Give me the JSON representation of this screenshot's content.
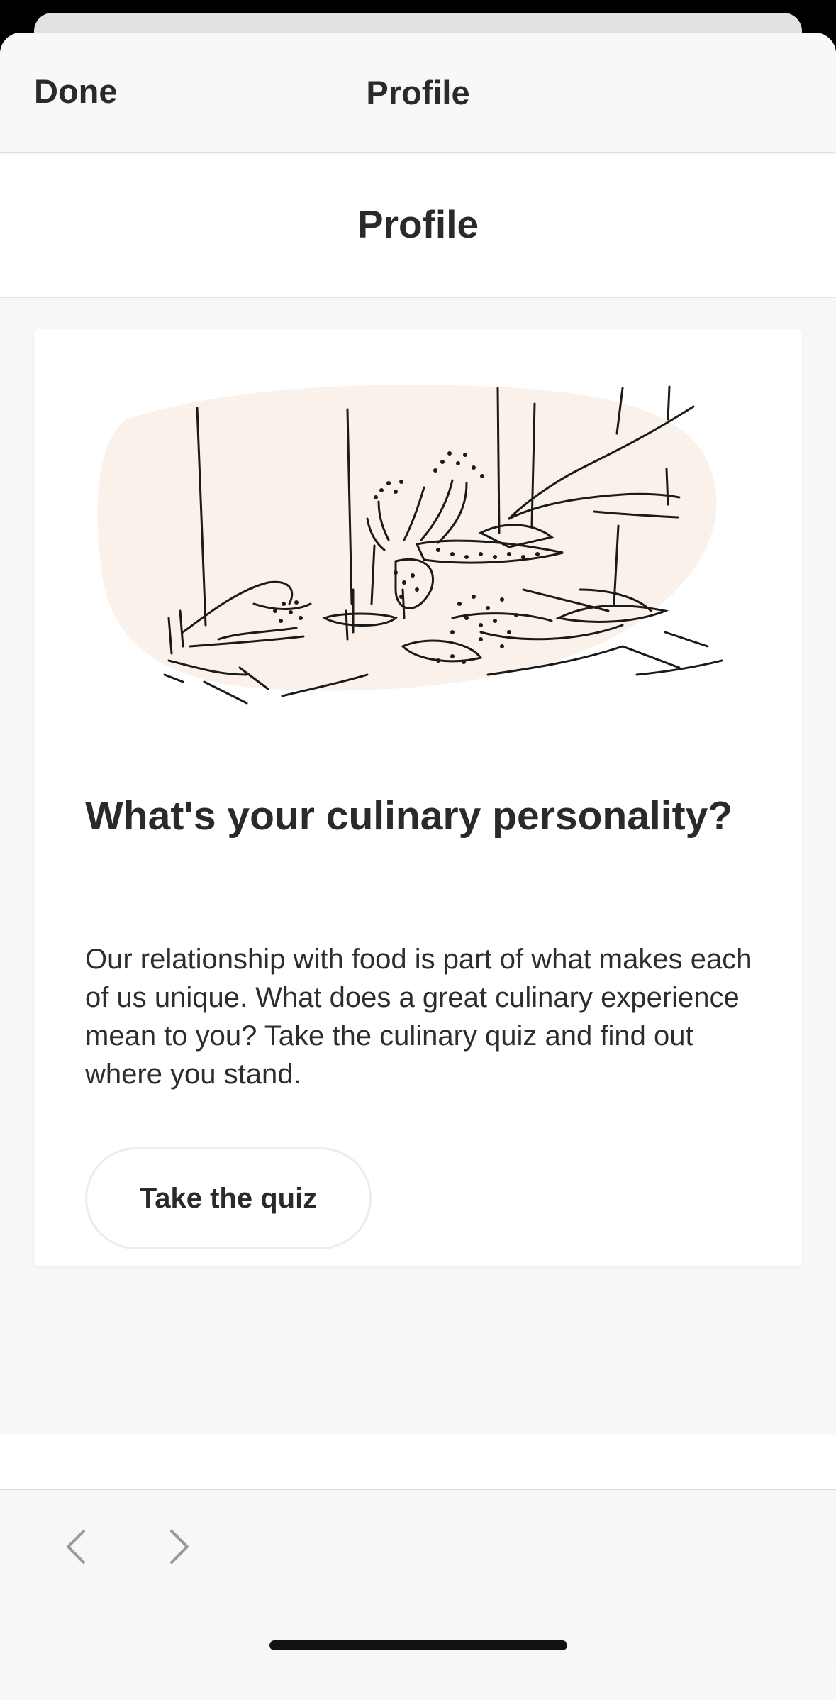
{
  "nav": {
    "done_label": "Done",
    "title": "Profile"
  },
  "page": {
    "title": "Profile"
  },
  "card": {
    "heading": "What's your culinary personality?",
    "body": "Our relationship with food is part of what makes each of us unique. What does a great culinary experience mean to you? Take the culinary quiz and find out where you stand.",
    "button_label": "Take the quiz",
    "illustration_icon": "dining-table-illustration"
  },
  "toolbar": {
    "back_icon": "chevron-left-icon",
    "forward_icon": "chevron-right-icon"
  },
  "colors": {
    "blob": "#faf2ea",
    "text": "#2a2a2a",
    "disabled": "#9a9a9a"
  }
}
